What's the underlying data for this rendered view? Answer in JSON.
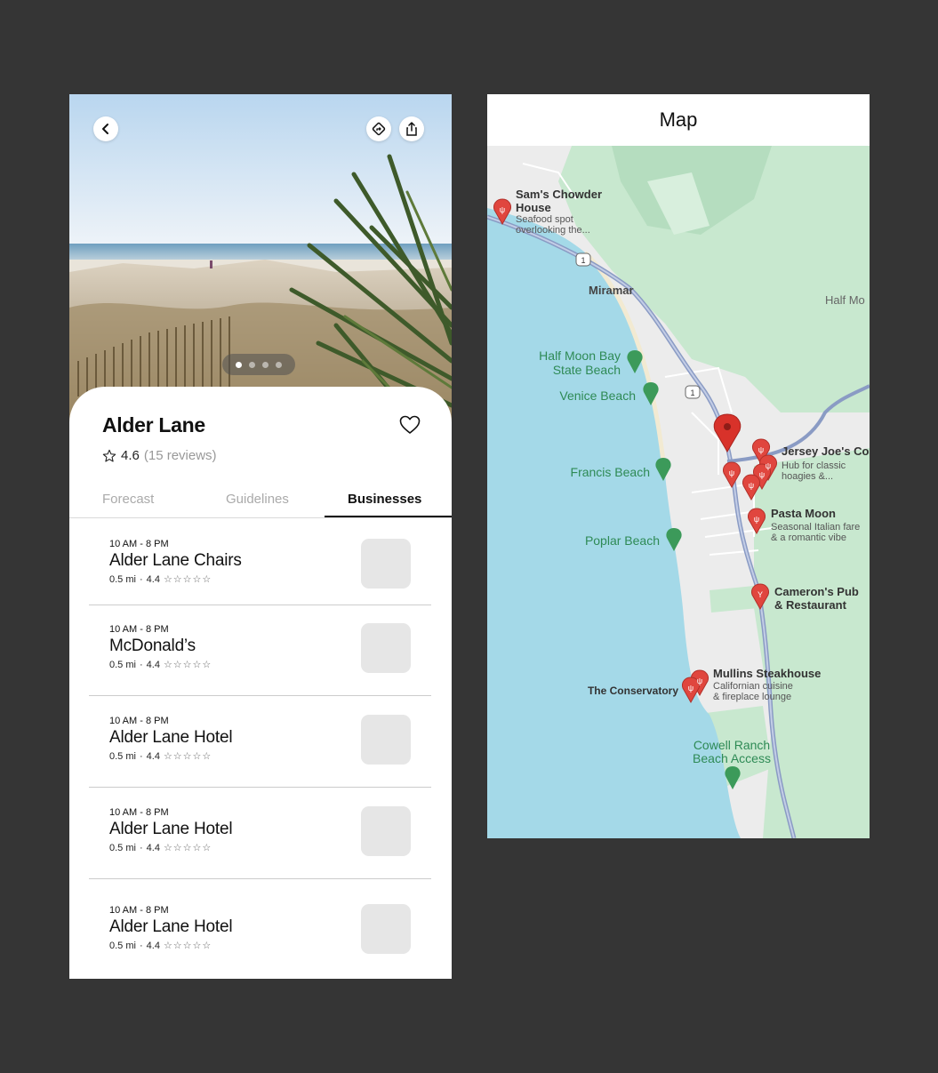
{
  "detail": {
    "title": "Alder Lane",
    "rating": "4.6",
    "reviews": "(15 reviews)",
    "carousel_count": 4,
    "carousel_active": 0,
    "tabs": [
      {
        "label": "Forecast"
      },
      {
        "label": "Guidelines"
      },
      {
        "label": "Businesses"
      }
    ],
    "active_tab": 2,
    "businesses": [
      {
        "hours": "10 AM - 8 PM",
        "name": "Alder Lane Chairs",
        "distance": "0.5 mi",
        "sep": "·",
        "rating": "4.4",
        "stars": "☆☆☆☆☆"
      },
      {
        "hours": "10 AM - 8 PM",
        "name": "McDonald’s",
        "distance": "0.5 mi",
        "sep": "·",
        "rating": "4.4",
        "stars": "☆☆☆☆☆"
      },
      {
        "hours": "10 AM - 8 PM",
        "name": "Alder Lane Hotel",
        "distance": "0.5 mi",
        "sep": "·",
        "rating": "4.4",
        "stars": "☆☆☆☆☆"
      },
      {
        "hours": "10 AM - 8 PM",
        "name": "Alder Lane Hotel",
        "distance": "0.5 mi",
        "sep": "·",
        "rating": "4.4",
        "stars": "☆☆☆☆☆"
      },
      {
        "hours": "10 AM - 8 PM",
        "name": "Alder Lane Hotel",
        "distance": "0.5 mi",
        "sep": "·",
        "rating": "4.4",
        "stars": "☆☆☆☆☆"
      }
    ]
  },
  "map_screen": {
    "title": "Map",
    "places": {
      "sams_title1": "Sam's Chowder",
      "sams_title2": "House",
      "sams_desc1": "Seafood spot",
      "sams_desc2": "overlooking the...",
      "miramar": "Miramar",
      "half_moon_right": "Half Mo",
      "hmb1": "Half Moon Bay",
      "hmb2": "State Beach",
      "venice": "Venice Beach",
      "francis": "Francis Beach",
      "poplar": "Poplar Beach",
      "jersey_title": "Jersey Joe's Coa",
      "jersey_desc1": "Hub for classic",
      "jersey_desc2": "hoagies &...",
      "pasta_title": "Pasta Moon",
      "pasta_desc1": "Seasonal Italian fare",
      "pasta_desc2": "& a romantic vibe",
      "camerons1": "Cameron's Pub",
      "camerons2": "& Restaurant",
      "mullins_title": "Mullins Steakhouse",
      "mullins_desc1": "Californian cuisine",
      "mullins_desc2": "& fireplace lounge",
      "conservatory": "The Conservatory",
      "cowell1": "Cowell Ranch",
      "cowell2": "Beach Access",
      "route": "1"
    }
  },
  "icons": {
    "back": "chevron-left-icon",
    "directions": "directions-icon",
    "share": "share-icon",
    "favorite": "heart-icon",
    "rating": "star-outline-icon"
  },
  "colors": {
    "ocean": "#a4d9e8",
    "land": "#ececec",
    "park": "#c8e8cf",
    "restaurant_pin": "#e0463e",
    "park_pin": "#3c9a5a"
  }
}
